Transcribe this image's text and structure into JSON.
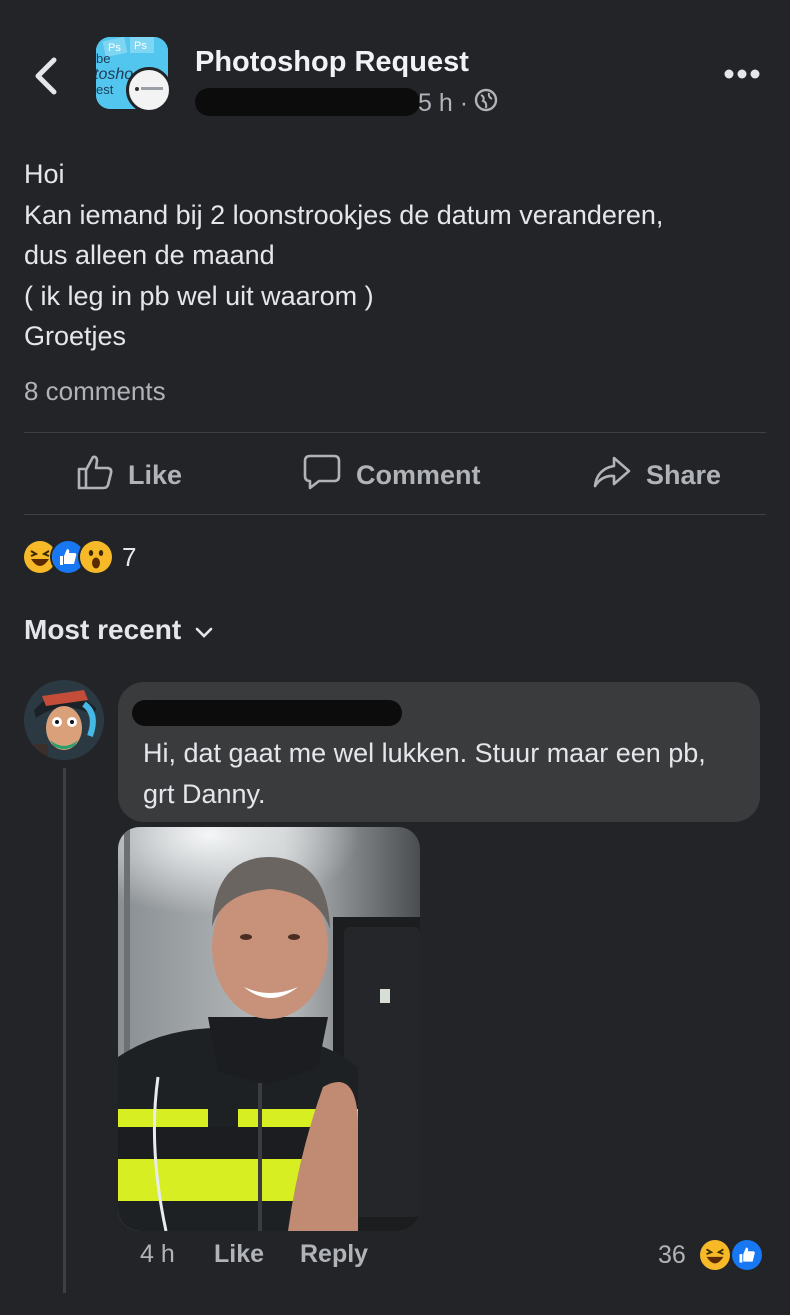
{
  "header": {
    "group_name": "Photoshop Request",
    "time": "5 h ·",
    "group_icon_text": [
      "Ps",
      "Ps",
      "be",
      "tosho",
      "est"
    ]
  },
  "post": {
    "lines": [
      "Hoi",
      "Kan iemand bij 2 loonstrookjes de datum veranderen,",
      "dus alleen de maand",
      "( ik leg in pb wel uit waarom )",
      "Groetjes"
    ],
    "comment_count": "8 comments"
  },
  "actions": {
    "like": "Like",
    "comment": "Comment",
    "share": "Share"
  },
  "reactions": {
    "count": "7",
    "types": [
      "haha",
      "like",
      "wow"
    ]
  },
  "sort": {
    "label": "Most recent"
  },
  "comment": {
    "text": "Hi, dat gaat me wel lukken. Stuur maar een pb, grt Danny.",
    "time": "4 h",
    "like": "Like",
    "reply": "Reply",
    "reaction_count": "36",
    "reaction_types": [
      "haha",
      "like"
    ]
  },
  "colors": {
    "background": "#232427",
    "bubble": "#3a3b3c",
    "text_primary": "#e4e6eb",
    "text_secondary": "#b0b3b8",
    "like_blue": "#1877f2",
    "haha_yellow": "#f7b928",
    "vest_yellow": "#d7ef22"
  }
}
